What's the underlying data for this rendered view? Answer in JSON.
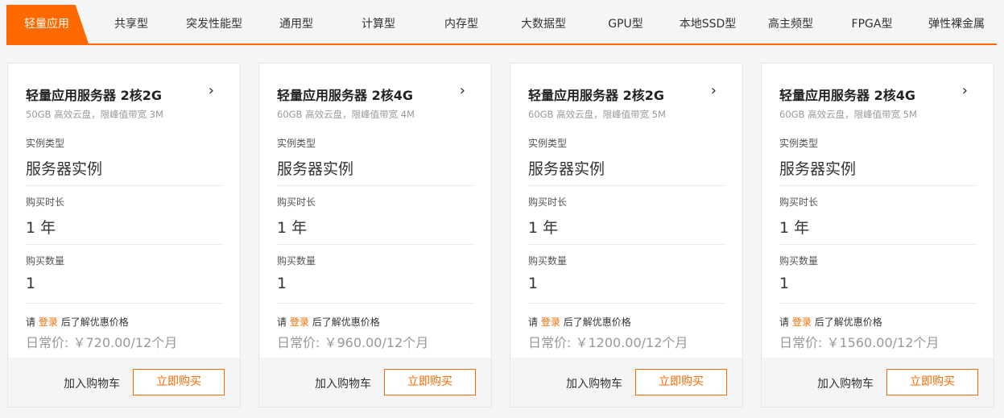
{
  "tabs": [
    {
      "label": "轻量应用",
      "active": true
    },
    {
      "label": "共享型"
    },
    {
      "label": "突发性能型"
    },
    {
      "label": "通用型"
    },
    {
      "label": "计算型"
    },
    {
      "label": "内存型"
    },
    {
      "label": "大数据型"
    },
    {
      "label": "GPU型"
    },
    {
      "label": "本地SSD型"
    },
    {
      "label": "高主频型"
    },
    {
      "label": "FPGA型"
    },
    {
      "label": "弹性裸金属"
    }
  ],
  "colors": {
    "accent": "#ff6a00"
  },
  "fields": {
    "type_label": "实例类型",
    "duration_label": "购买时长",
    "quantity_label": "购买数量"
  },
  "login_prefix": "请",
  "login_link": "登录",
  "login_suffix": "后了解优惠价格",
  "cart_label": "加入购物车",
  "buy_label": "立即购买",
  "arrow_icon": "chevron-right-icon",
  "cards": [
    {
      "title": "轻量应用服务器 2核2G",
      "subtitle": "50GB 高效云盘，限峰值带宽 3M",
      "type": "服务器实例",
      "duration": "1 年",
      "quantity": "1",
      "price": "日常价: ￥720.00/12个月"
    },
    {
      "title": "轻量应用服务器 2核4G",
      "subtitle": "60GB 高效云盘，限峰值带宽 4M",
      "type": "服务器实例",
      "duration": "1 年",
      "quantity": "1",
      "price": "日常价: ￥960.00/12个月"
    },
    {
      "title": "轻量应用服务器 2核2G",
      "subtitle": "60GB 高效云盘，限峰值带宽 5M",
      "type": "服务器实例",
      "duration": "1 年",
      "quantity": "1",
      "price": "日常价: ￥1200.00/12个月"
    },
    {
      "title": "轻量应用服务器 2核4G",
      "subtitle": "60GB 高效云盘，限峰值带宽 5M",
      "type": "服务器实例",
      "duration": "1 年",
      "quantity": "1",
      "price": "日常价: ￥1560.00/12个月"
    }
  ]
}
